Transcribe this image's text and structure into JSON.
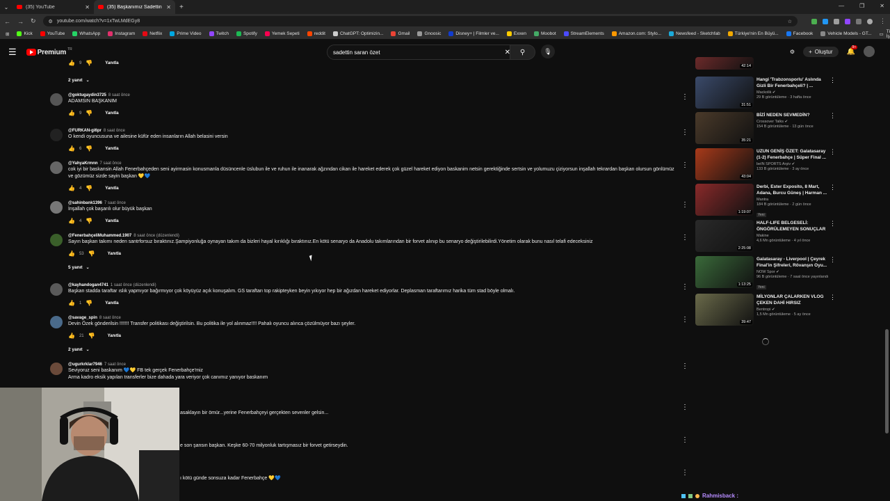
{
  "browser": {
    "tabs": [
      {
        "title": "(35) YouTube",
        "active": false
      },
      {
        "title": "(35) Başkanımız Sadettin S...",
        "active": true
      }
    ],
    "url": "youtube.com/watch?v=1xTwLMdEGy8",
    "bookmarks": [
      {
        "label": "Kick",
        "color": "#53fc18"
      },
      {
        "label": "YouTube",
        "color": "#ff0000"
      },
      {
        "label": "WhatsApp",
        "color": "#25d366"
      },
      {
        "label": "Instagram",
        "color": "#e1306c"
      },
      {
        "label": "Netflix",
        "color": "#e50914"
      },
      {
        "label": "Prime Video",
        "color": "#00a8e1"
      },
      {
        "label": "Twitch",
        "color": "#9146ff"
      },
      {
        "label": "Spotify",
        "color": "#1db954"
      },
      {
        "label": "Yemek Sepeti",
        "color": "#fa0050"
      },
      {
        "label": "reddit",
        "color": "#ff4500"
      },
      {
        "label": "ChatGPT: Optimizin...",
        "color": "#cccccc"
      },
      {
        "label": "Gmail",
        "color": "#ea4335"
      },
      {
        "label": "Gnoosic",
        "color": "#999999"
      },
      {
        "label": "Disney+ | Filmler ve...",
        "color": "#113ccf"
      },
      {
        "label": "Exxen",
        "color": "#ffcc00"
      },
      {
        "label": "Moobot",
        "color": "#44aa66"
      },
      {
        "label": "StreamElements",
        "color": "#4b4bff"
      },
      {
        "label": "Amazon.com: Stylo...",
        "color": "#ff9900"
      },
      {
        "label": "Newsfeed - Sketchfab",
        "color": "#1caad9"
      },
      {
        "label": "Türkiye'nin En Büyü...",
        "color": "#f2a900"
      },
      {
        "label": "Facebook",
        "color": "#1877f2"
      },
      {
        "label": "Vehicle Models - GT...",
        "color": "#888888"
      }
    ],
    "all_bookmarks": "Tüm Yer İşaretleri"
  },
  "youtube": {
    "logo_text": "Premium",
    "logo_region": "TR",
    "search_value": "sadettin saran özet",
    "create_label": "Oluştur",
    "notif_badge": "9+"
  },
  "comments": [
    {
      "type": "actions",
      "likes": "9",
      "reply": "Yanıtla"
    },
    {
      "type": "replies",
      "label": "2 yanıt"
    },
    {
      "type": "comment",
      "author": "@goktugaydin3725",
      "time": "8 saat önce",
      "text": "ADAMSIN BAŞKANIM",
      "likes": "9",
      "reply": "Yanıtla",
      "avatar": "#555555"
    },
    {
      "type": "comment",
      "author": "@FURKAN-gi6pr",
      "time": "8 saat önce",
      "text": "O kendi oyuncusuna ve ailesine küfür eden insanların Allah belasini versin",
      "likes": "6",
      "reply": "Yanıtla",
      "avatar": "#222222"
    },
    {
      "type": "comment",
      "author": "@YahyaKrmnn",
      "time": "7 saat önce",
      "text": "cok iyi bir baskansin Allah Fenerbahçeden seni ayirmasin konusmanla düsüncenle üslubun ile ve ruhun ile inanarak ağzından cikan ile hareket ederek çok güzel hareket ediyon baskanim netsin gerektiğinde sertsin ve yolumuzu çiziyorsun inşallah tekrardan başkan olursun gönlümüz ve gözümüz sizde sayin başkan 💛💙",
      "likes": "4",
      "reply": "Yanıtla",
      "avatar": "#666666"
    },
    {
      "type": "comment",
      "author": "@sahinbank1396",
      "time": "7 saat önce",
      "text": "İnşallah çok başarılı olur büyük başkan",
      "likes": "4",
      "reply": "Yanıtla",
      "avatar": "#777777"
    },
    {
      "type": "comment",
      "author": "@FenerbahçeliMuhammed.1907",
      "time": "8 saat önce (düzenlendi)",
      "text": "Sayın başkan takımı neden santrforsuz bıraktınız.Şampiyonluğa oynayan takım da bizleri hayal kırıklığı bıraktınız.En kötü senaryo da Anadolu takımlarından bir forvet alınıp bu senaryo değiştirilebilirdi.Yönetim olarak bunu nasıl telafi edeceksiniz",
      "likes": "53",
      "reply": "Yanıtla",
      "avatar": "#3a5f2a"
    },
    {
      "type": "replies",
      "label": "5 yanıt"
    },
    {
      "type": "comment",
      "author": "@kayhandogan4741",
      "time": "1 saat önce (düzenlendi)",
      "text": "Başkan stadda taraftar ıslık yapmıyor bağırmıyor çok köyüyüz açık konuşalım. GS taraftarı top rakipteyken beyin yıkıyor hep bir ağızdan hareket ediyorlar. Deplasman taraftarımız harika tüm stad böyle olmalı.",
      "likes": "1",
      "reply": "Yanıtla",
      "avatar": "#5a5a5a"
    },
    {
      "type": "comment",
      "author": "@savage_spin",
      "time": "8 saat önce",
      "text": "Devin Özek gönderilsin !!!!!!! Transfer politikası değiştirilsin. Bu politika ile yol alınmaz!!!! Pahalı oyuncu alınca çözülmüyor bazı şeyler.",
      "likes": "21",
      "reply": "Yanıtla",
      "avatar": "#4a6a8a"
    },
    {
      "type": "replies",
      "label": "2 yanıt"
    },
    {
      "type": "comment",
      "author": "@ugurkrklar7946",
      "time": "7 saat önce",
      "text": "Seviyoruz seni baskanım 💙💛 FB tek gerçek Fenerbahçe'miz",
      "text2": "Arma kadro eksik yapılan transferler bize dahada yara veriyor çok canımız yanıyor baskanım",
      "likes": "",
      "reply": "",
      "avatar": "#6a4a3a"
    }
  ],
  "partial_comments": [
    {
      "text": "asaklayın bir ömür...yerine Fenerbahçeyi gerçekten sevenler gelsin..."
    },
    {
      "text": "e son şansın başkan. Keşke 60-70 milyonluk tartışmasız bir forvet getirseydin."
    },
    {
      "text": "ı kötü günde sonsuza kadar Fenerbahçe 💛💙"
    }
  ],
  "sidebar": [
    {
      "title": "",
      "channel": "",
      "stats": "",
      "duration": "42:14",
      "thumb": "#6b2a2a"
    },
    {
      "title": "Hangi 'Trabzonsporlu' Aslında Gizli Bir Fenerbahçeli? | ...",
      "channel": "Mackolik",
      "stats": "29 B görüntüleme · 3 hafta önce",
      "duration": "31:51",
      "thumb": "#3a4a6a",
      "verified": true
    },
    {
      "title": "BİZİ NEDEN SEVMEDİN?",
      "channel": "Crossover Talks",
      "stats": "154 B görüntüleme · 13 gün önce",
      "duration": "35:21",
      "thumb": "#4a3a2a",
      "verified": true
    },
    {
      "title": "UZUN GENİŞ ÖZET: Galatasaray (1-2) Fenerbahçe | Süper Final ...",
      "channel": "beIN SPORTS Arşiv",
      "stats": "133 B görüntüleme · 3 ay önce",
      "duration": "43:04",
      "thumb": "#a83a1a",
      "verified": true
    },
    {
      "title": "Derbi, Ester Exposito, 8 Mart, Adana, Burcu Güneş | Harman ...",
      "channel": "Mantra",
      "stats": "184 B görüntüleme · 2 gün önce",
      "duration": "1:19:07",
      "thumb": "#8a2a2a",
      "new": "Yeni"
    },
    {
      "title": "HALF-LIFE BELGESELİ: ÖNGÖRÜLEMEYEN SONUÇLAR",
      "channel": "Makine",
      "stats": "4,6 Mn görüntüleme · 4 yıl önce",
      "duration": "2:25:08",
      "thumb": "#2a2a2a"
    },
    {
      "title": "Galatasaray - Liverpool | Çeyrek Final'in Şifreleri, Rövanşın Oyu...",
      "channel": "NOW Spor",
      "stats": "96 B görüntüleme · 7 saat önce yayınlandı",
      "duration": "1:13:25",
      "thumb": "#3a6a3a",
      "verified": true,
      "new": "Yeni"
    },
    {
      "title": "MİLYONLAR ÇALARKEN VLOG ÇEKEN DAHİ HIRSIZ",
      "channel": "Bentropi",
      "stats": "1,5 Mn görüntüleme · 5 ay önce",
      "duration": "39:47",
      "thumb": "#6a6a4a",
      "verified": true
    }
  ],
  "stream": {
    "tag": "Rahmisback :"
  }
}
